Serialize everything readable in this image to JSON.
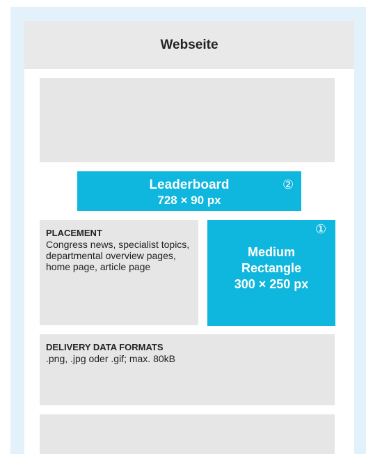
{
  "header": {
    "title": "Webseite"
  },
  "leaderboard": {
    "name": "Leaderboard",
    "size": "728 × 90 px",
    "marker": "②"
  },
  "placement": {
    "heading": "PLACEMENT",
    "text": "Congress news, specialist topics, departmental overview pages, home page, article page"
  },
  "medium_rectangle": {
    "marker": "①",
    "line1": "Medium",
    "line2": "Rectangle",
    "size": "300 × 250 px"
  },
  "delivery": {
    "heading": "DELIVERY DATA FORMATS",
    "text": ".png, .jpg oder .gif; max. 80kB"
  },
  "colors": {
    "frame": "#e2f1fa",
    "ad_accent": "#0fb6dd",
    "placeholder": "#e6e6e6",
    "header_bg": "#e9e9e9"
  }
}
